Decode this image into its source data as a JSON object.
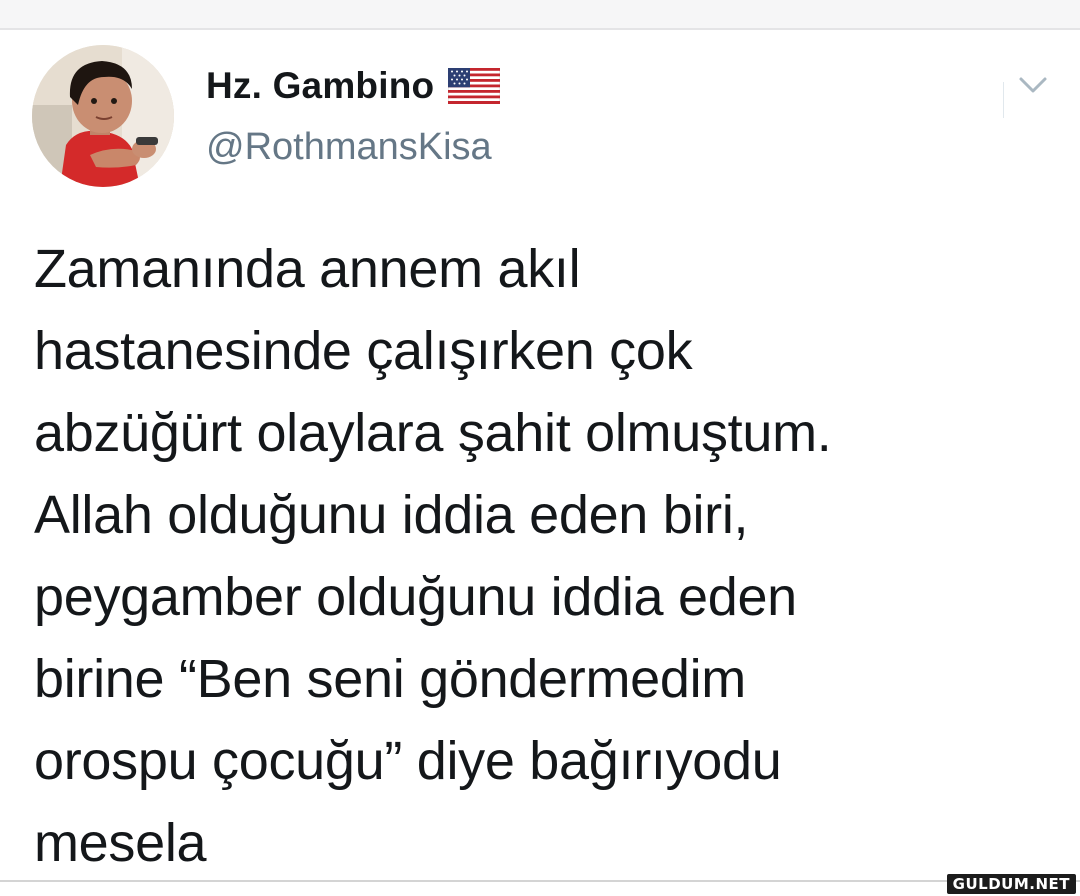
{
  "tweet": {
    "display_name": "Hz. Gambino",
    "handle": "@RothmansKisa",
    "flag_icon": "us-flag-icon",
    "menu_icon": "chevron-down-icon",
    "text": "Zamanında annem akıl\nhastanesinde çalışırken çok\nabzüğürt olaylara şahit olmuştum.\nAllah olduğunu iddia eden biri,\npeygamber olduğunu iddia eden\nbirine “Ben seni göndermedim\norospu çocuğu” diye bağırıyodu\nmesela"
  },
  "watermark": {
    "text": "GULDUM.NET"
  },
  "colors": {
    "text_primary": "#14171a",
    "text_secondary": "#657786",
    "chevron": "#aab8c2"
  }
}
